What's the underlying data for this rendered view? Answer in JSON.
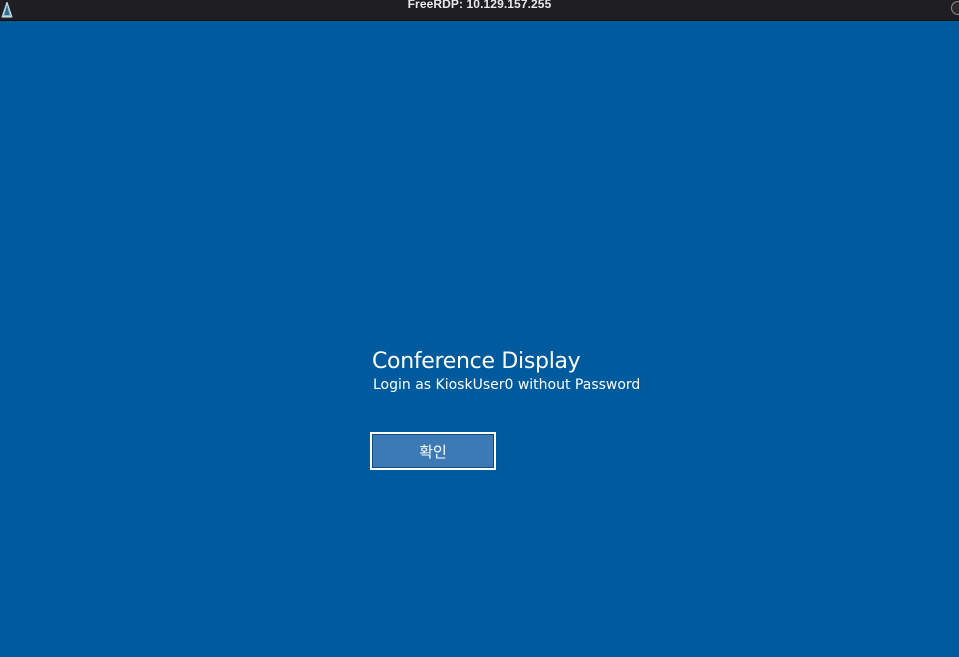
{
  "window": {
    "title": "FreeRDP: 10.129.157.255",
    "app_icon": "freerdp-icon",
    "corner_control_icon": "window-control-icon"
  },
  "login": {
    "title": "Conference Display",
    "subtitle": "Login as KioskUser0 without Password",
    "confirm_button_label": "확인"
  },
  "colors": {
    "desktop_background": "#005a9e",
    "titlebar_background": "#1f1f23",
    "button_background": "#3c7ab5",
    "button_border": "#ffffff",
    "text": "#ffffff"
  }
}
